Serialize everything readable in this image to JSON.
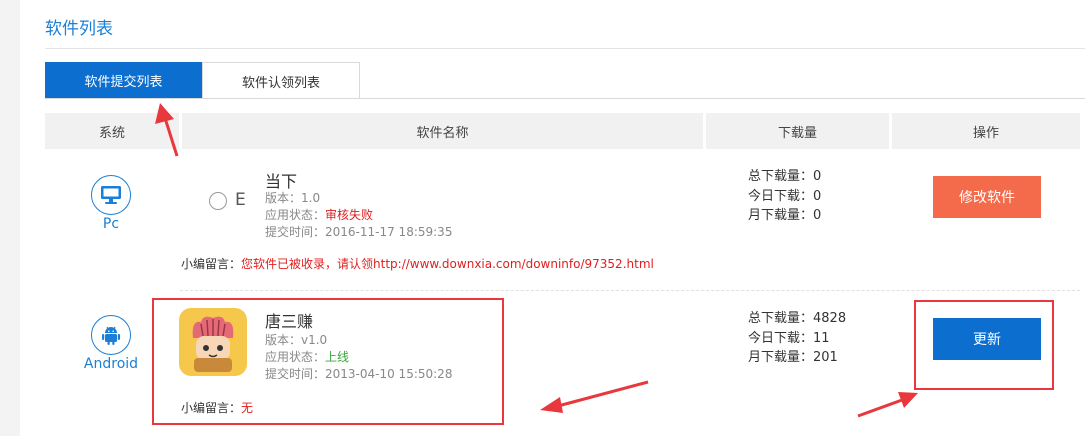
{
  "page": {
    "title": "软件列表"
  },
  "tabs": [
    {
      "label": "软件提交列表",
      "active": true
    },
    {
      "label": "软件认领列表",
      "active": false
    }
  ],
  "table": {
    "headers": [
      "系统",
      "软件名称",
      "下载量",
      "操作"
    ]
  },
  "rows": [
    {
      "system": "Pc",
      "system_icon": "monitor-icon",
      "name": "当下",
      "name_fragment": "E",
      "version": "版本：1.0",
      "status_label": "应用状态：",
      "status_value": "审核失败",
      "submit_time": "提交时间：2016-11-17 18:59:35",
      "downloads": {
        "total": "总下载量：0",
        "today": "今日下载：0",
        "month": "月下载量：0"
      },
      "note_label": "小编留言：",
      "note_value": "您软件已被收录，请认领http://www.downxia.com/downinfo/97352.html",
      "action": "修改软件",
      "action_color": "#f36b4b"
    },
    {
      "system": "Android",
      "system_icon": "android-icon",
      "name": "唐三赚",
      "version": "版本：v1.0",
      "status_label": "应用状态：",
      "status_value": "上线",
      "submit_time": "提交时间：2013-04-10 15:50:28",
      "downloads": {
        "total": "总下载量：4828",
        "today": "今日下载：11",
        "month": "月下载量：201"
      },
      "note_label": "小编留言：",
      "note_value": "无",
      "action": "更新",
      "action_color": "#0c6fd0"
    }
  ],
  "colors": {
    "accent": "#1a7fd6",
    "tab_active": "#0c6fd0",
    "annotation": "#e8383d"
  }
}
